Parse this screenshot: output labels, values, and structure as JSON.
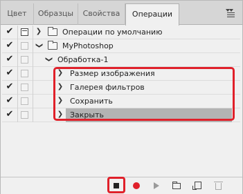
{
  "tabs": [
    {
      "label": "Цвет",
      "active": false
    },
    {
      "label": "Образцы",
      "active": false
    },
    {
      "label": "Свойства",
      "active": false
    },
    {
      "label": "Операции",
      "active": true
    }
  ],
  "actions": {
    "set_default": "Операции по умолчанию",
    "set_custom": "MyPhotoshop",
    "action": "Обработка-1",
    "steps": [
      {
        "label": "Размер изображения",
        "selected": false
      },
      {
        "label": "Галерея фильтров",
        "selected": false
      },
      {
        "label": "Сохранить",
        "selected": false
      },
      {
        "label": "Закрыть",
        "selected": true
      }
    ]
  },
  "icons": {
    "check": "checkmark-icon",
    "dialog_toggle": "dialog-toggle-icon",
    "folder": "folder-icon",
    "expand": "chevron-right-icon",
    "collapse": "chevron-down-icon"
  },
  "toolbar": {
    "buttons": [
      "stop-recording",
      "begin-recording",
      "play-selection",
      "create-new-set",
      "create-new-action",
      "delete"
    ]
  },
  "colors": {
    "highlight": "#e0202a",
    "selected_row": "#b3b3b3",
    "record": "#e0202a"
  }
}
